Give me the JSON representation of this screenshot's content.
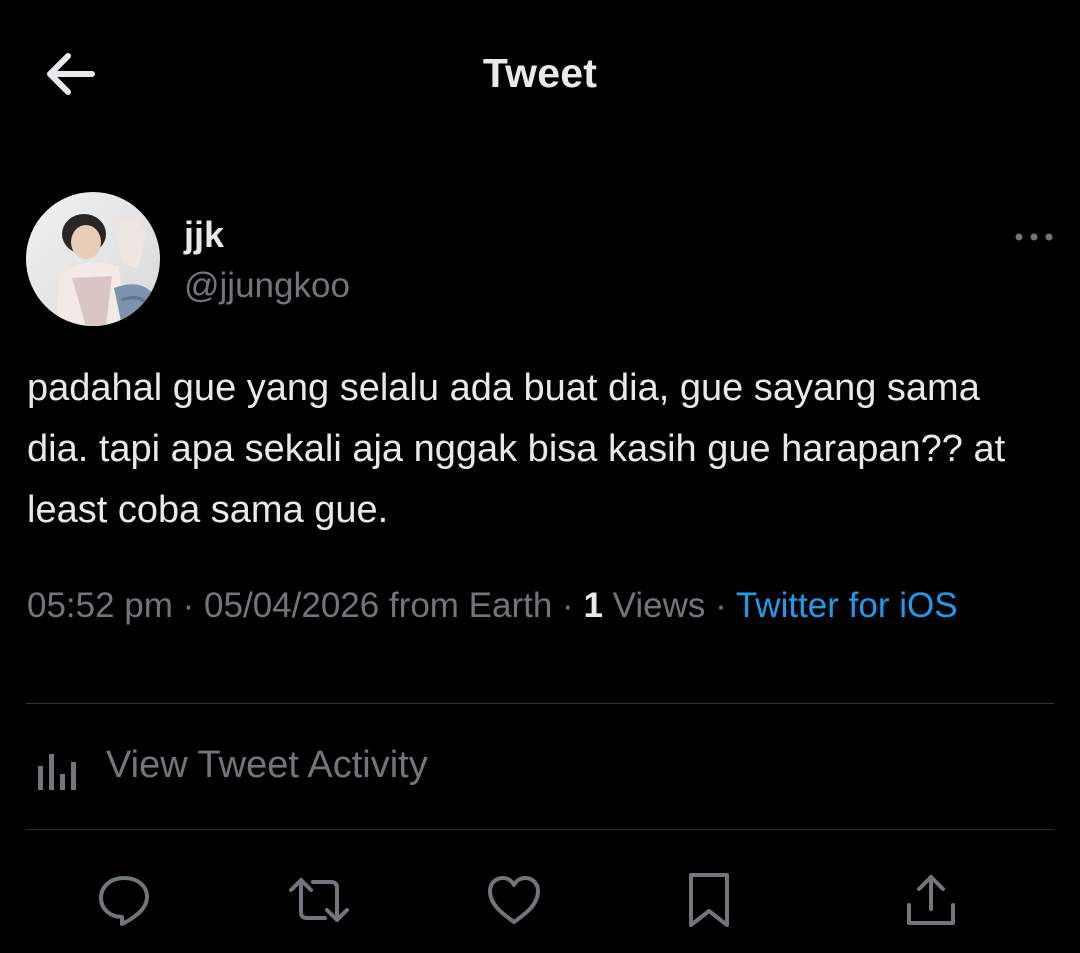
{
  "header": {
    "title": "Tweet",
    "back_icon": "arrow-left-icon"
  },
  "author": {
    "display_name": "jjk",
    "handle": "@jjungkoo",
    "avatar": "avatar-photo",
    "more_icon": "more-horizontal-icon"
  },
  "tweet": {
    "text": "padahal gue yang selalu ada buat dia, gue sayang sama dia. tapi apa sekali aja nggak bisa kasih gue harapan?? at least coba sama gue."
  },
  "meta": {
    "time": "05:52 pm",
    "separator": " · ",
    "date": "05/04/2026",
    "location": " from Earth",
    "views_count": "1",
    "views_label": " Views",
    "source": "Twitter for iOS"
  },
  "activity": {
    "label": "View Tweet Activity",
    "icon": "analytics-bars-icon"
  },
  "actions": [
    {
      "name": "reply",
      "icon": "reply-icon"
    },
    {
      "name": "retweet",
      "icon": "retweet-icon"
    },
    {
      "name": "like",
      "icon": "heart-icon"
    },
    {
      "name": "bookmark",
      "icon": "bookmark-icon"
    },
    {
      "name": "share",
      "icon": "share-icon"
    }
  ],
  "colors": {
    "background": "#000000",
    "text_primary": "#e7e9ea",
    "text_secondary": "#71767b",
    "accent": "#1d9bf0",
    "divider": "#2f3336"
  }
}
